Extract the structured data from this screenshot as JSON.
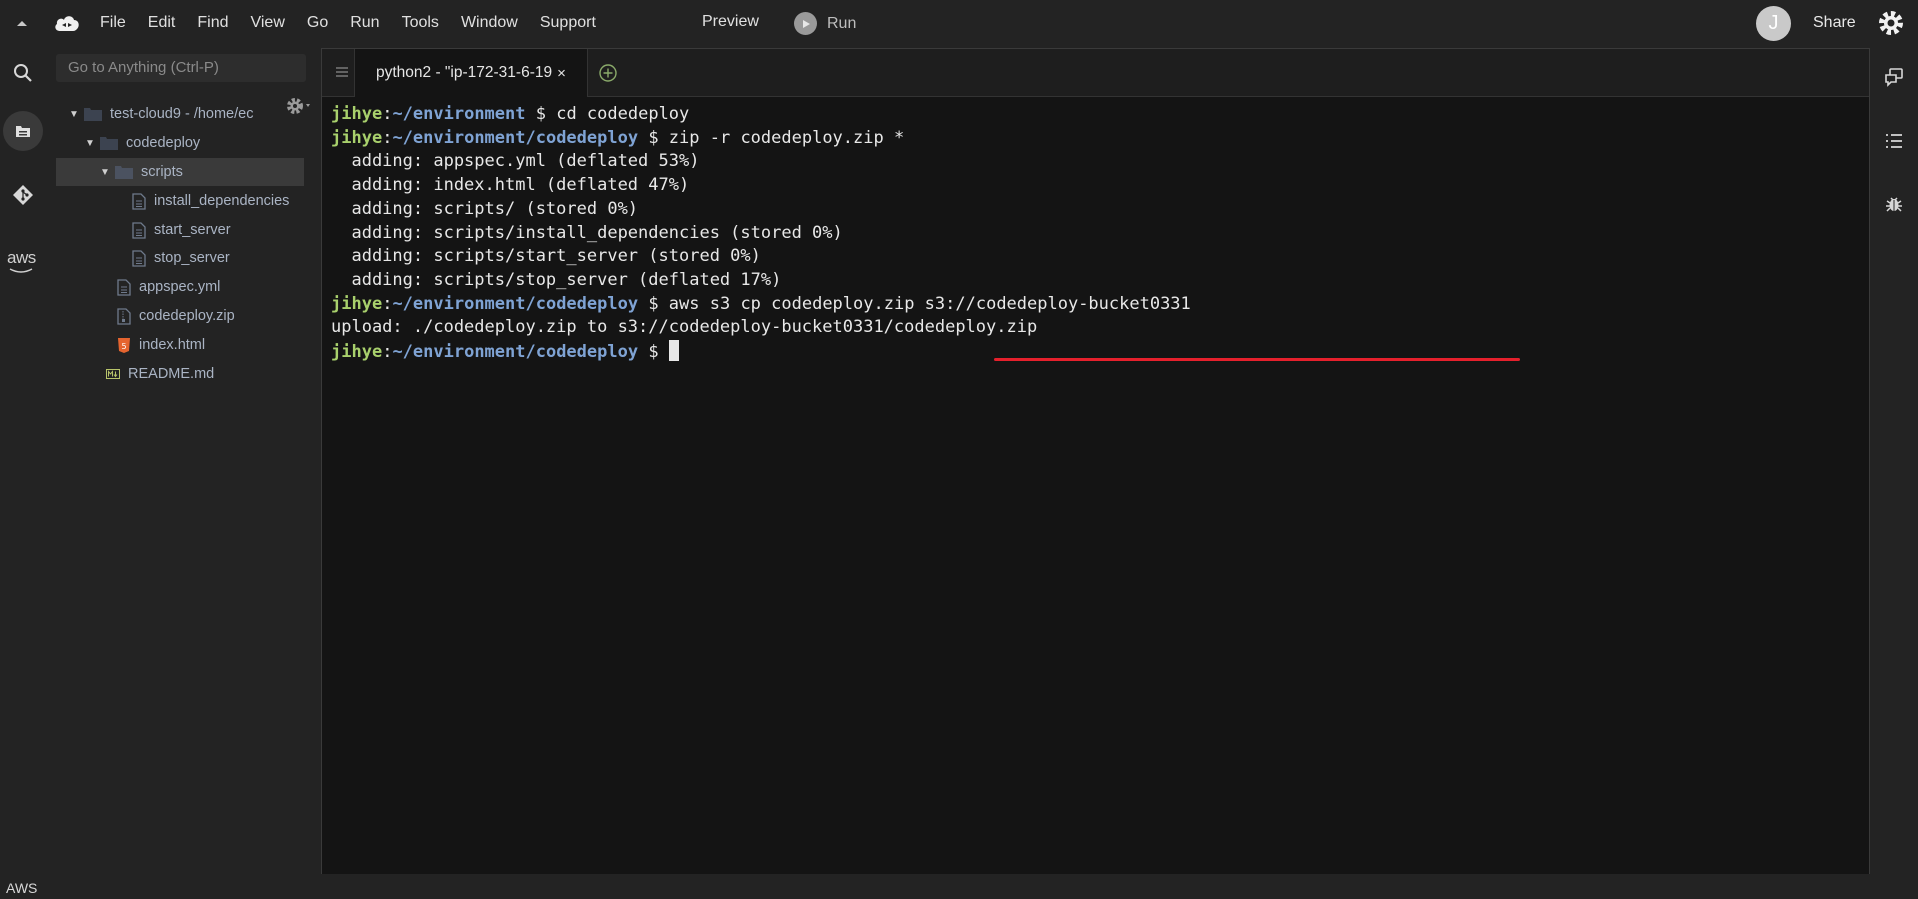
{
  "menubar": {
    "menus": [
      "File",
      "Edit",
      "Find",
      "View",
      "Go",
      "Run",
      "Tools",
      "Window",
      "Support"
    ],
    "preview_label": "Preview",
    "run_label": "Run",
    "avatar_initial": "J",
    "share_label": "Share"
  },
  "activity": {
    "aws_label": "aws"
  },
  "sidebar": {
    "goto_placeholder": "Go to Anything (Ctrl-P)",
    "tree": {
      "root": "test-cloud9 - /home/ec",
      "codedeploy": "codedeploy",
      "scripts": "scripts",
      "install_dependencies": "install_dependencies",
      "start_server": "start_server",
      "stop_server": "stop_server",
      "appspec": "appspec.yml",
      "zip": "codedeploy.zip",
      "index": "index.html",
      "readme": "README.md"
    }
  },
  "terminal": {
    "tab_title": "python2 - \"ip-172-31-6-19",
    "tab_close": "×",
    "user": "jihye",
    "colon": ":",
    "path_env": "~/environment",
    "path_cd": "~/environment/codedeploy",
    "prompt_symbol": " $ ",
    "cmd1": "cd codedeploy",
    "cmd2": "zip -r codedeploy.zip *",
    "out1": "  adding: appspec.yml (deflated 53%)",
    "out2": "  adding: index.html (deflated 47%)",
    "out3": "  adding: scripts/ (stored 0%)",
    "out4": "  adding: scripts/install_dependencies (stored 0%)",
    "out5": "  adding: scripts/start_server (stored 0%)",
    "out6": "  adding: scripts/stop_server (deflated 17%)",
    "cmd3": "aws s3 cp codedeploy.zip s3://codedeploy-bucket0331",
    "out7": "upload: ./codedeploy.zip to s3://codedeploy-bucket0331/codedeploy.zip"
  },
  "status": {
    "label": "AWS"
  },
  "colors": {
    "user_green": "#a8d06c",
    "path_blue": "#7fa3d4",
    "underline_red": "#e5202c",
    "terminal_bg": "#141414"
  }
}
